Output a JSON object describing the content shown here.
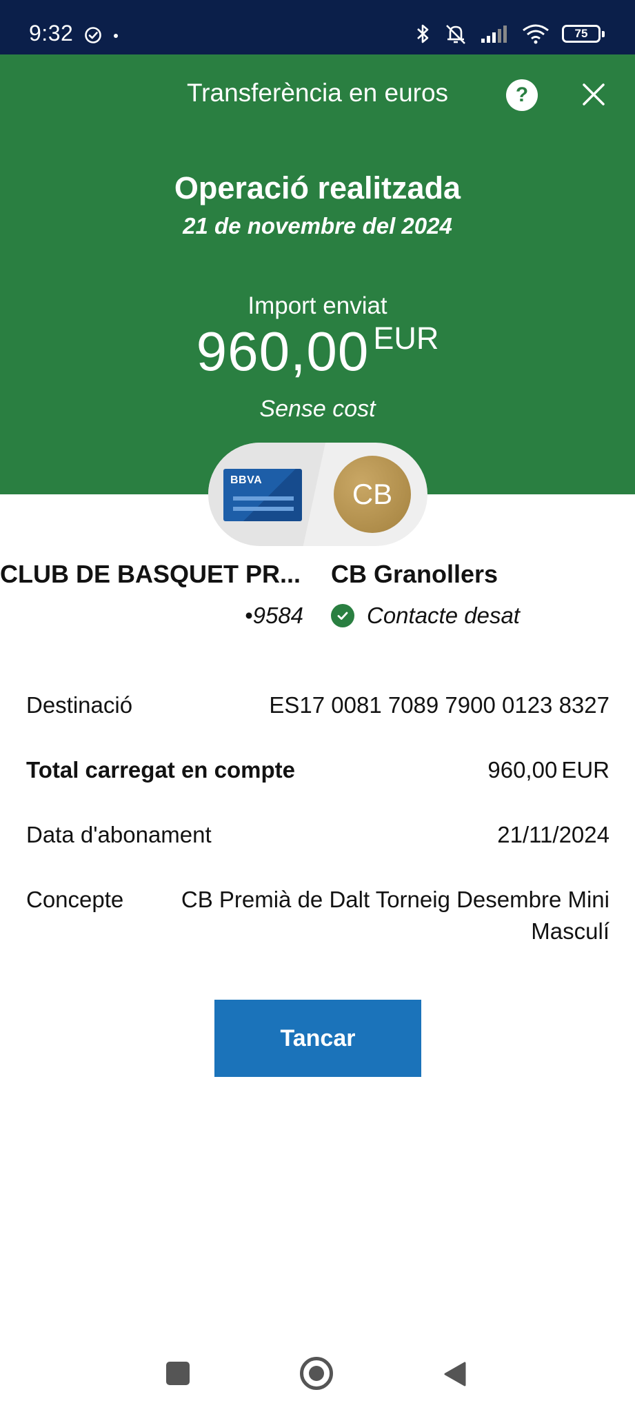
{
  "status_bar": {
    "time": "9:32",
    "battery": "75"
  },
  "header": {
    "title": "Transferència en euros",
    "help_icon_label": "?"
  },
  "hero": {
    "status_title": "Operació realitzada",
    "status_date": "21 de novembre del 2024",
    "amount_label": "Import enviat",
    "amount_value": "960,00",
    "amount_currency": "EUR",
    "fee_text": "Sense cost"
  },
  "avatars": {
    "bank_logo": "BBVA",
    "contact_initials": "CB"
  },
  "origin": {
    "name": "CLUB DE BASQUET PR...",
    "account_suffix": "•9584"
  },
  "destination": {
    "name": "CB Granollers",
    "contact_status": "Contacte desat"
  },
  "details": {
    "destination_label": "Destinació",
    "destination_value": "ES17 0081 7089 7900 0123 8327",
    "total_label": "Total carregat en compte",
    "total_value": "960,00",
    "total_currency": "EUR",
    "date_label": "Data d'abonament",
    "date_value": "21/11/2024",
    "concept_label": "Concepte",
    "concept_value": "CB Premià de Dalt Torneig Desembre Mini Masculí"
  },
  "actions": {
    "close_label": "Tancar"
  },
  "colors": {
    "hero_green": "#2a7f41",
    "status_bar": "#0b1f4a",
    "button_blue": "#1b73ba"
  }
}
